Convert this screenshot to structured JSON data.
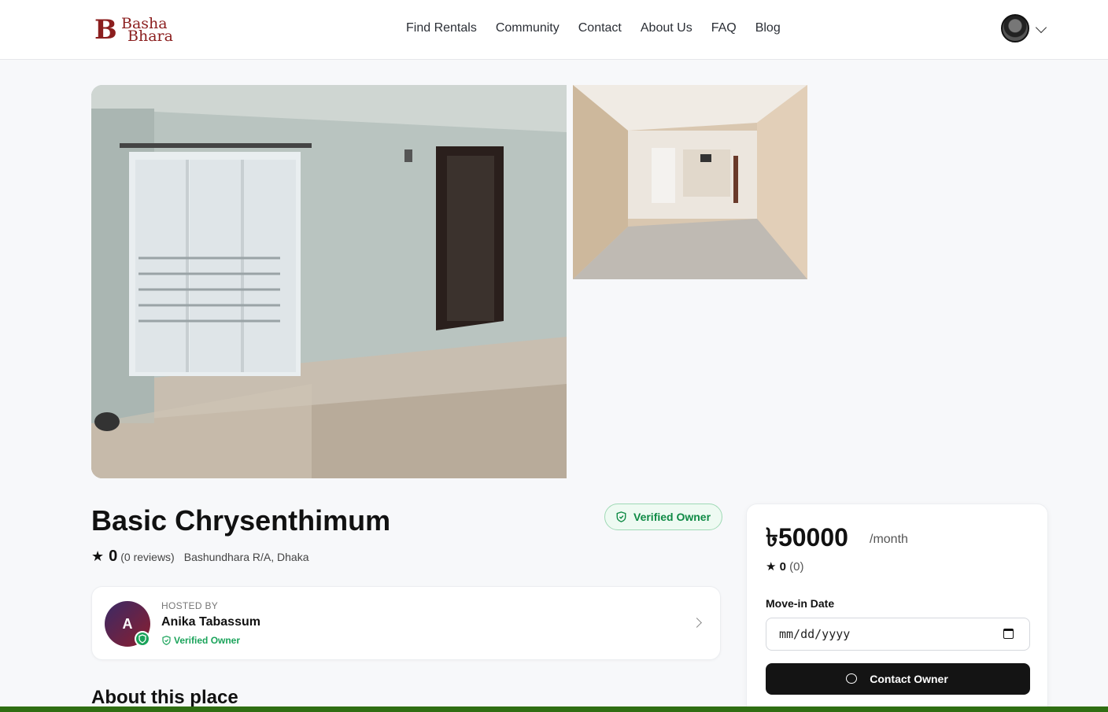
{
  "brand": {
    "line1": "Basha",
    "line2": "Bhara"
  },
  "nav": {
    "items": [
      "Find Rentals",
      "Community",
      "Contact",
      "About Us",
      "FAQ",
      "Blog"
    ]
  },
  "listing": {
    "title": "Basic Chrysenthimum",
    "verified_label": "Verified Owner",
    "rating": "0",
    "reviews": "(0 reviews)",
    "location": "Bashundhara R/A, Dhaka"
  },
  "host": {
    "label": "HOSTED BY",
    "initial": "A",
    "name": "Anika Tabassum",
    "verified": "Verified Owner"
  },
  "about": {
    "title": "About this place"
  },
  "booking": {
    "price": "৳50000",
    "period": "/month",
    "rating": "0",
    "rating_count": "(0)",
    "move_in_label": "Move-in Date",
    "date_value": "mm/dd/yyyy",
    "contact_label": "Contact Owner"
  },
  "colors": {
    "brand": "#8b1e1e",
    "verified_green": "#1aa35a",
    "button": "#141414"
  }
}
